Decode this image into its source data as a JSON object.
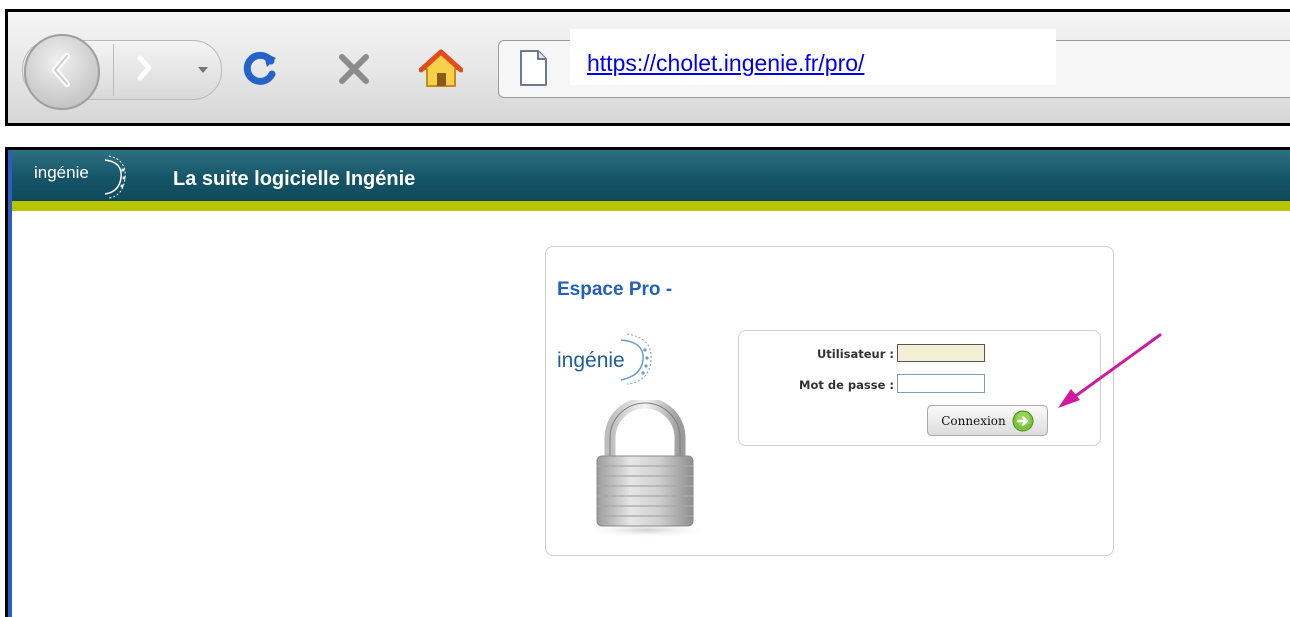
{
  "browser": {
    "url": "https://cholet.ingenie.fr/pro/",
    "icons": [
      "back-icon",
      "forward-icon",
      "history-dropdown-icon",
      "reload-icon",
      "stop-icon",
      "home-icon",
      "page-icon"
    ]
  },
  "app_header": {
    "logo_text": "ingénie",
    "title": "La suite logicielle Ingénie"
  },
  "login": {
    "heading": "Espace Pro -",
    "logo_text": "ingénie",
    "username_label": "Utilisateur :",
    "username_value": "",
    "password_label": "Mot de passe :",
    "password_value": "",
    "submit_label": "Connexion"
  },
  "colors": {
    "header_teal": "#155568",
    "header_lime": "#b8c400",
    "heading_blue": "#2461b8",
    "annotation_arrow": "#d1189e",
    "username_field_bg": "#f3efd4"
  }
}
